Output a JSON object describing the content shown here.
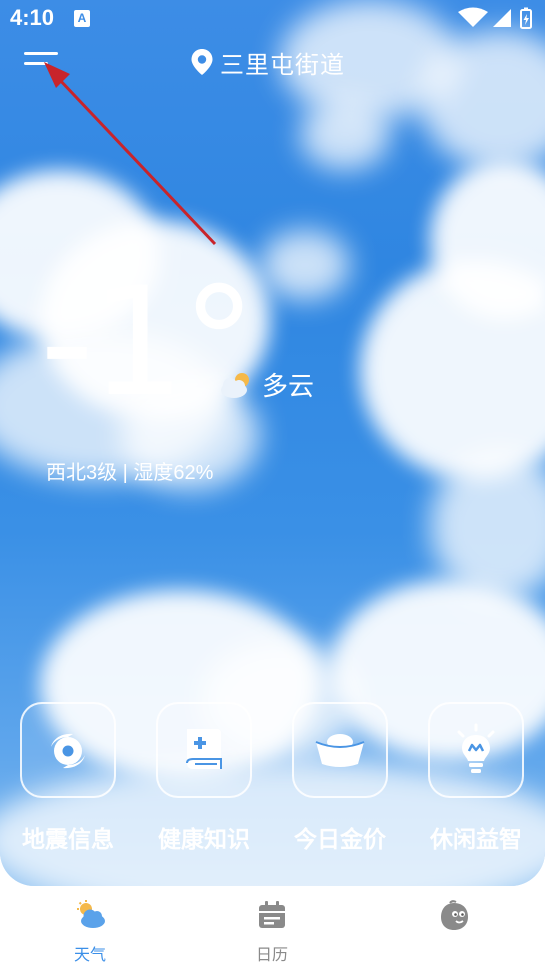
{
  "status_bar": {
    "time": "4:10",
    "notification_letter": "A",
    "icons": [
      "wifi-icon",
      "signal-icon",
      "battery-icon"
    ]
  },
  "header": {
    "menu_icon": "hamburger-menu-icon",
    "location_icon": "location-pin-icon",
    "location": "三里屯街道"
  },
  "weather": {
    "temperature": "-1°",
    "condition_icon": "partly-cloudy-icon",
    "condition": "多云",
    "wind_humidity": "西北3级 | 湿度62%"
  },
  "shortcuts": [
    {
      "label": "地震信息",
      "icon": "typhoon-swirl-icon"
    },
    {
      "label": "健康知识",
      "icon": "health-book-icon"
    },
    {
      "label": "今日金价",
      "icon": "gold-ingot-icon"
    },
    {
      "label": "休闲益智",
      "icon": "lightbulb-icon"
    }
  ],
  "tabs": [
    {
      "label": "天气",
      "icon": "weather-tab-icon",
      "active": true
    },
    {
      "label": "日历",
      "icon": "calendar-tab-icon",
      "active": false
    },
    {
      "label": "",
      "icon": "mascot-face-icon",
      "active": false
    }
  ],
  "colors": {
    "sky_blue": "#2f86e1",
    "active_tab": "#3b8fe8",
    "inactive_tab": "#8a8a8a",
    "annotation_arrow": "#c8242b"
  }
}
